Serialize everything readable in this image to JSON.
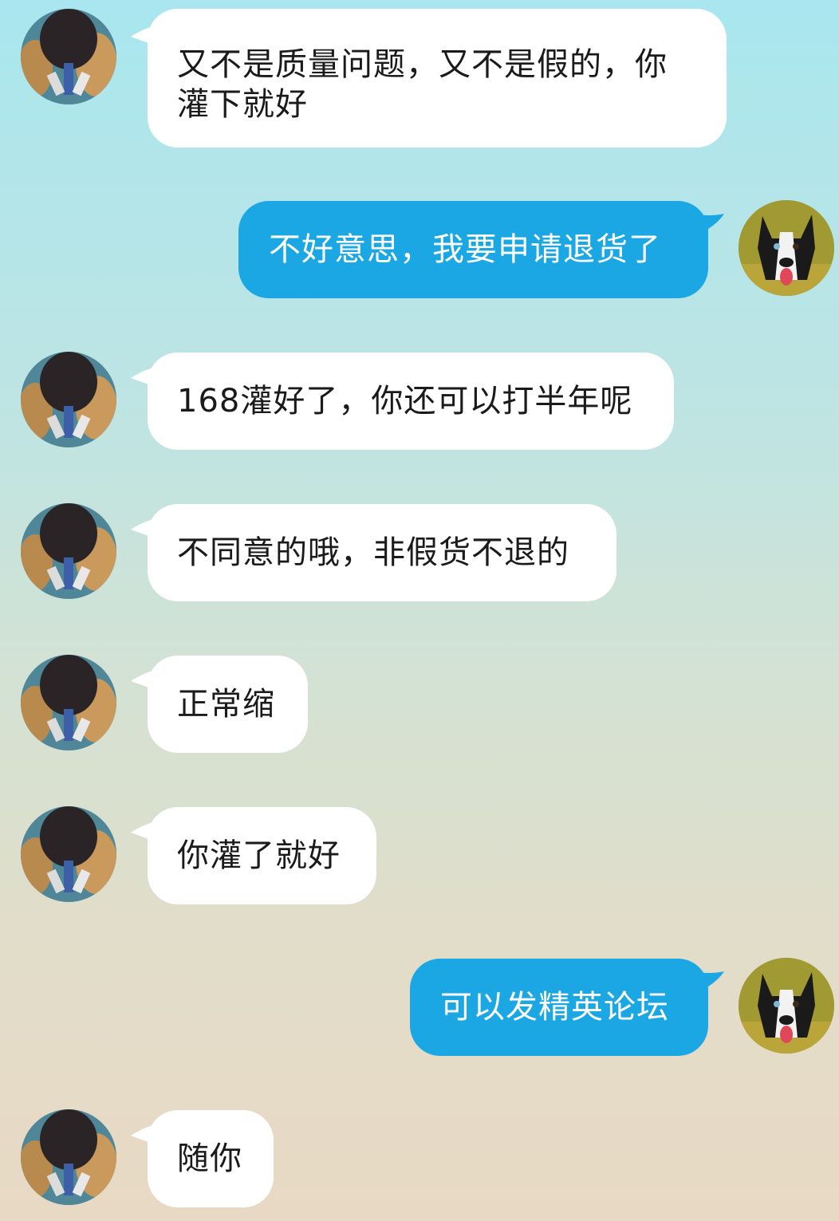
{
  "colors": {
    "incoming_bubble": "#ffffff",
    "outgoing_bubble": "#1aa7e4",
    "outgoing_text": "#ffffff",
    "incoming_text": "#1a1a1a"
  },
  "avatars": {
    "incoming": "table-tennis-paddle-avatar",
    "outgoing": "husky-dog-avatar"
  },
  "messages": [
    {
      "sender": "incoming",
      "text": "又不是质量问题，又不是假的，你\n灌下就好"
    },
    {
      "sender": "outgoing",
      "text": "不好意思，我要申请退货了"
    },
    {
      "sender": "incoming",
      "text": "168灌好了，你还可以打半年呢"
    },
    {
      "sender": "incoming",
      "text": "不同意的哦，非假货不退的"
    },
    {
      "sender": "incoming",
      "text": "正常缩"
    },
    {
      "sender": "incoming",
      "text": "你灌了就好"
    },
    {
      "sender": "outgoing",
      "text": "可以发精英论坛"
    },
    {
      "sender": "incoming",
      "text": "随你"
    }
  ]
}
